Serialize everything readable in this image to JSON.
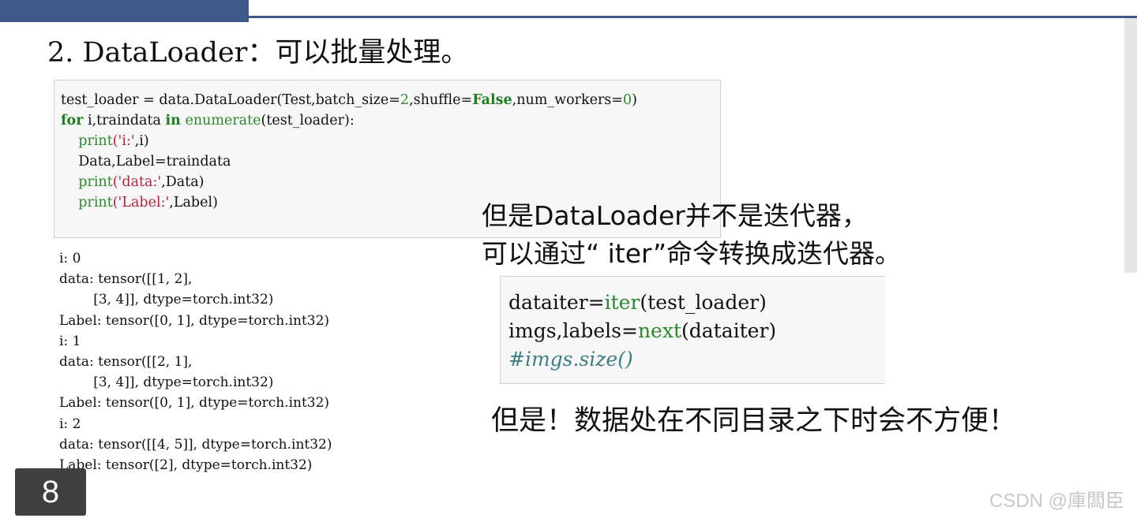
{
  "title": "2. DataLoader：可以批量处理。",
  "code_cell": {
    "line1": {
      "a": "test_loader = data.DataLoader(Test,batch_size=",
      "n1": "2",
      "b": ",shuffle=",
      "kw": "False",
      "c": ",num_workers=",
      "n2": "0",
      "d": ")"
    },
    "line2": {
      "kw1": "for",
      "a": " i,traindata ",
      "kw2": "in",
      "sp": " ",
      "bi": "enumerate",
      "b": "(test_loader):"
    },
    "line3": {
      "indent": "    ",
      "bi": "print",
      "str": "('i:'",
      "rest": ",i)"
    },
    "line4": {
      "text": "    Data,Label=traindata"
    },
    "line5": {
      "indent": "    ",
      "bi": "print",
      "str": "('data:'",
      "rest": ",Data)"
    },
    "line6": {
      "indent": "    ",
      "bi": "print",
      "str": "('Label:'",
      "rest": ",Label)"
    }
  },
  "output_lines": [
    "i: 0",
    "data: tensor([[1, 2],",
    "        [3, 4]], dtype=torch.int32)",
    "Label: tensor([0, 1], dtype=torch.int32)",
    "i: 1",
    "data: tensor([[2, 1],",
    "        [3, 4]], dtype=torch.int32)",
    "Label: tensor([0, 1], dtype=torch.int32)",
    "i: 2",
    "data: tensor([[4, 5]], dtype=torch.int32)",
    "Label: tensor([2], dtype=torch.int32)"
  ],
  "note_line1": "但是DataLoader并不是迭代器，",
  "note_line2": "可以通过“ iter”命令转换成迭代器。",
  "iter_cell": {
    "line1": {
      "a": "dataiter=",
      "bi": "iter",
      "b": "(test_loader)"
    },
    "line2": {
      "a": "imgs,labels=",
      "bi": "next",
      "b": "(dataiter)"
    },
    "line3": {
      "cm": "#imgs.size()"
    }
  },
  "warning": "但是！数据处在不同目录之下时会不方便！",
  "page_number": "8",
  "watermark": "CSDN @庫闆臣",
  "colors": {
    "header_bar": "#3e5a88",
    "keyword": "#1d7f1d",
    "string": "#b5223b",
    "comment": "#3b7f86"
  }
}
